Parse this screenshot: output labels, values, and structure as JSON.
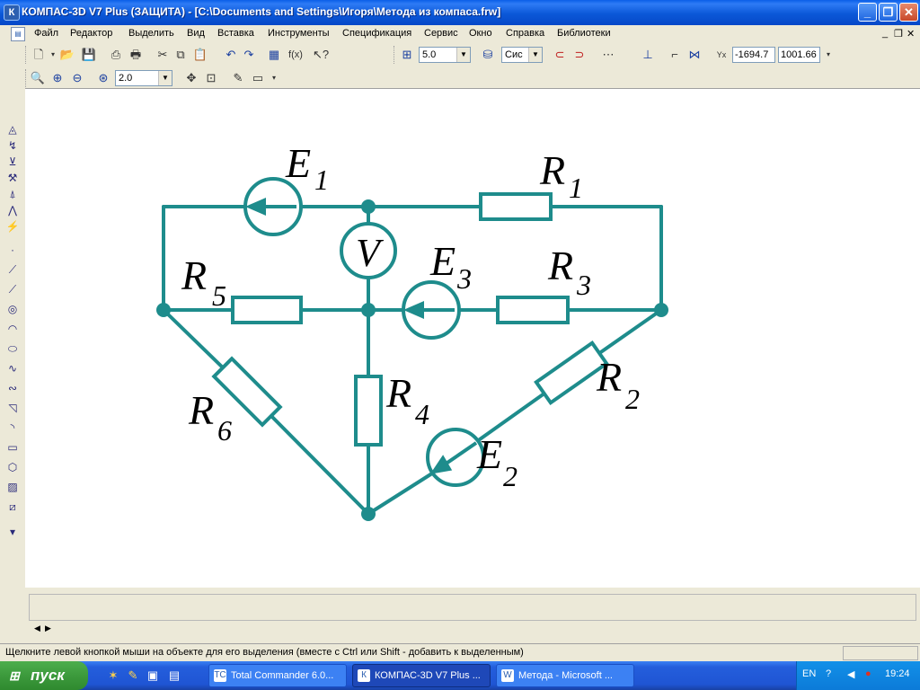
{
  "window": {
    "title": "КОМПАС-3D V7 Plus (ЗАЩИТА) - [C:\\Documents and Settings\\Игоря\\Метода из компаса.frw]",
    "app_icon": "К"
  },
  "menu": [
    "Файл",
    "Редактор",
    "Выделить",
    "Вид",
    "Вставка",
    "Инструменты",
    "Спецификация",
    "Сервис",
    "Окно",
    "Справка",
    "Библиотеки"
  ],
  "toolbar": {
    "step_value": "5.0",
    "layer_value": "Сис",
    "x_coord": "-1694.7",
    "y_coord": "1001.66",
    "zoom_value": "2.0",
    "fx_label": "f(x)"
  },
  "circuit": {
    "labels": {
      "E1": "E",
      "E1_sub": "1",
      "R1": "R",
      "R1_sub": "1",
      "V": "V",
      "E3": "E",
      "E3_sub": "3",
      "R3": "R",
      "R3_sub": "3",
      "R5": "R",
      "R5_sub": "5",
      "R2": "R",
      "R2_sub": "2",
      "R6": "R",
      "R6_sub": "6",
      "R4": "R",
      "R4_sub": "4",
      "E2": "E",
      "E2_sub": "2"
    },
    "colors": {
      "wire": "#1E8C8C",
      "label": "#000000",
      "canvas": "#FFFFFF"
    }
  },
  "status": {
    "text": "Щелкните левой кнопкой мыши на объекте для его выделения (вместе с Ctrl или Shift - добавить к выделенным)"
  },
  "taskbar": {
    "start_label": "пуск",
    "tasks": [
      {
        "label": "Total Commander 6.0...",
        "icon": "TC"
      },
      {
        "label": "КОМПАС-3D V7 Plus ...",
        "icon": "К"
      },
      {
        "label": "Метода - Microsoft ...",
        "icon": "W"
      }
    ],
    "tray": {
      "lang": "EN",
      "clock": "19:24"
    }
  },
  "colors": {
    "titlebar": "#0A5FE8",
    "taskbar": "#245EDC",
    "start": "#3C9A3C",
    "chrome": "#ECE9D8"
  }
}
